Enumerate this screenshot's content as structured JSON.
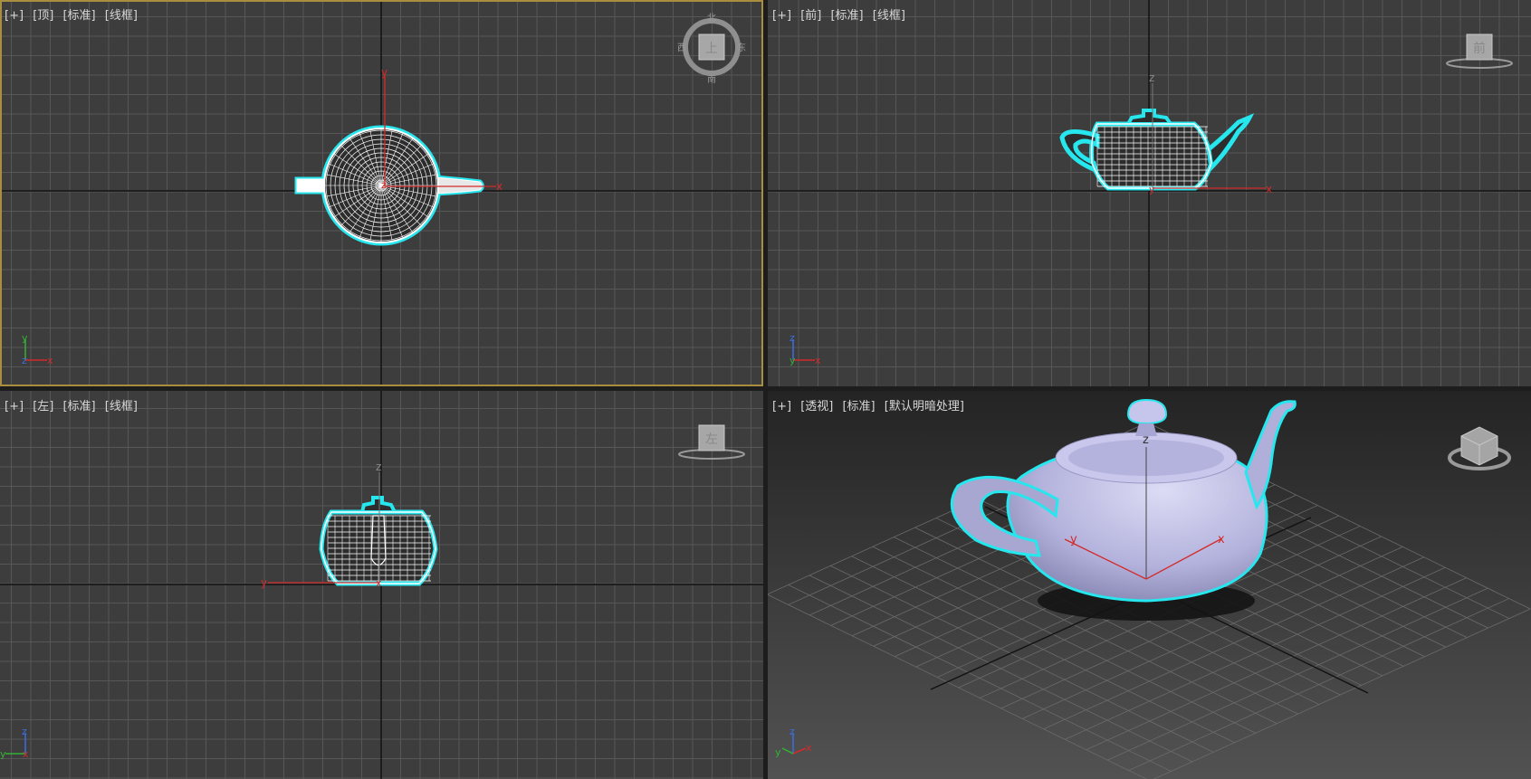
{
  "viewports": {
    "top": {
      "labels": [
        "[+]",
        "[顶]",
        "[标准]",
        "[线框]"
      ],
      "cube_face": "上",
      "compass": [
        "北",
        "东",
        "南",
        "西"
      ]
    },
    "front": {
      "labels": [
        "[+]",
        "[前]",
        "[标准]",
        "[线框]"
      ],
      "cube_face": "前"
    },
    "left": {
      "labels": [
        "[+]",
        "[左]",
        "[标准]",
        "[线框]"
      ],
      "cube_face": "左"
    },
    "persp": {
      "labels": [
        "[+]",
        "[透视]",
        "[标准]",
        "[默认明暗处理]"
      ]
    }
  },
  "axis_names": {
    "x": "x",
    "y": "y",
    "z": "z"
  },
  "colors": {
    "grid_bg": "#3d3d3d",
    "grid_line": "#575757",
    "axis_line": "#111111",
    "active_border": "#a98e3f",
    "selection": "#26e6ee",
    "teapot_fill": "#b9b8e0",
    "axis_x": "#d42a2a",
    "axis_y": "#34b234",
    "axis_z": "#3b6ee0"
  }
}
